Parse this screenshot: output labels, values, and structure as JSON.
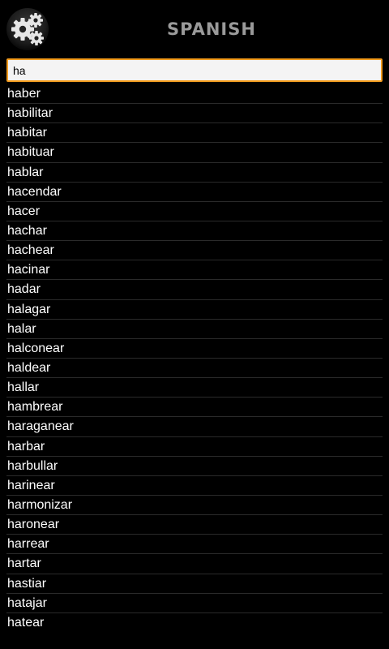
{
  "header": {
    "title": "SPANISH",
    "settings_icon": "gears-icon"
  },
  "search": {
    "value": "ha",
    "placeholder": ""
  },
  "colors": {
    "background": "#000000",
    "title": "#9a9a9a",
    "input_border": "#f39c1e",
    "input_bg": "#f4f4f4",
    "list_text": "#ffffff",
    "divider": "#2a2a2a"
  },
  "words": [
    "haber",
    "habilitar",
    "habitar",
    "habituar",
    "hablar",
    "hacendar",
    "hacer",
    "hachar",
    "hachear",
    "hacinar",
    "hadar",
    "halagar",
    "halar",
    "halconear",
    "haldear",
    "hallar",
    "hambrear",
    "haraganear",
    "harbar",
    "harbullar",
    "harinear",
    "harmonizar",
    "haronear",
    "harrear",
    "hartar",
    "hastiar",
    "hatajar",
    "hatear"
  ]
}
